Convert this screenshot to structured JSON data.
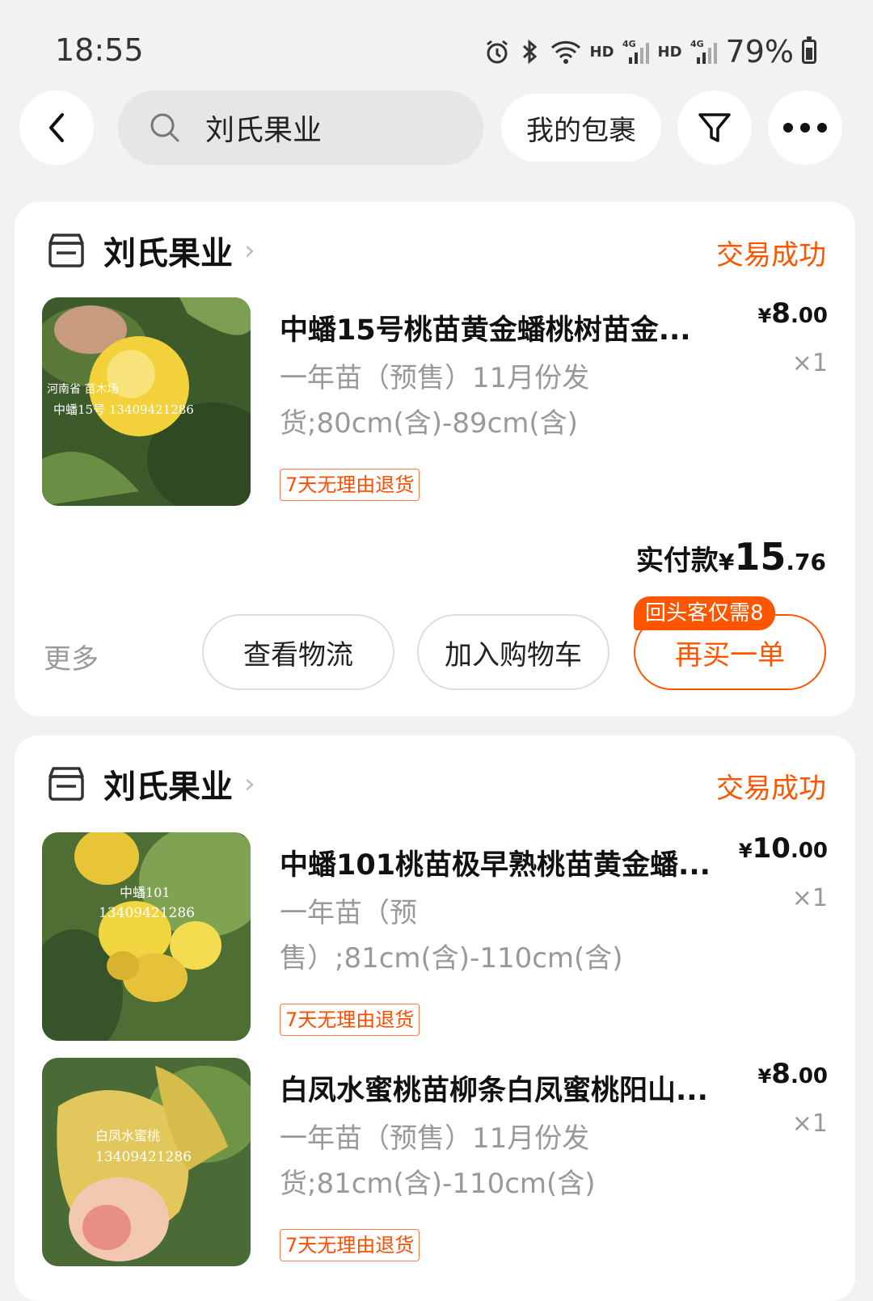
{
  "status_bar": {
    "time": "18:55",
    "hd1": "HD",
    "net1": "4G",
    "hd2": "HD",
    "net2": "4G",
    "battery_text": "79%",
    "battery_level": 0.79,
    "icons": [
      "alarm-icon",
      "bluetooth-icon",
      "wifi-icon",
      "signal-icon",
      "signal-icon",
      "battery-icon"
    ]
  },
  "header": {
    "search_text": "刘氏果业",
    "my_parcels": "我的包裹",
    "icons": [
      "back-arrow-icon",
      "search-icon",
      "filter-icon",
      "more-dots-icon"
    ]
  },
  "orders": [
    {
      "shop": "刘氏果业",
      "status": "交易成功",
      "items": [
        {
          "title": "中蟠15号桃苗黄金蟠桃树苗金...",
          "spec": "一年苗（预售）11月份发货;80cm(含)-89cm(含)",
          "tag": "7天无理由退货",
          "price_symbol": "¥",
          "price_int": "8",
          "price_dec": ".00",
          "qty": "×1",
          "image_text_1": "河南省 苗木场",
          "image_text_2": "中蟠15号 13409421286"
        }
      ],
      "paid_label": "实付款",
      "paid_symbol": "¥",
      "paid_int": "15",
      "paid_dec": ".76",
      "more": "更多",
      "btn_logistics": "查看物流",
      "btn_cart": "加入购物车",
      "btn_rebuy": "再买一单",
      "rebuy_badge": "回头客仅需8"
    },
    {
      "shop": "刘氏果业",
      "status": "交易成功",
      "items": [
        {
          "title": "中蟠101桃苗极早熟桃苗黄金蟠...",
          "spec": "一年苗（预售）;81cm(含)-110cm(含)",
          "tag": "7天无理由退货",
          "price_symbol": "¥",
          "price_int": "10",
          "price_dec": ".00",
          "qty": "×1",
          "image_text_1": "中蟠101",
          "image_text_2": "13409421286"
        },
        {
          "title": "白凤水蜜桃苗柳条白凤蜜桃阳山...",
          "spec": "一年苗（预售）11月份发货;81cm(含)-110cm(含)",
          "tag": "7天无理由退货",
          "price_symbol": "¥",
          "price_int": "8",
          "price_dec": ".00",
          "qty": "×1",
          "image_text_1": "白凤水蜜桃",
          "image_text_2": "13409421286"
        }
      ]
    }
  ]
}
